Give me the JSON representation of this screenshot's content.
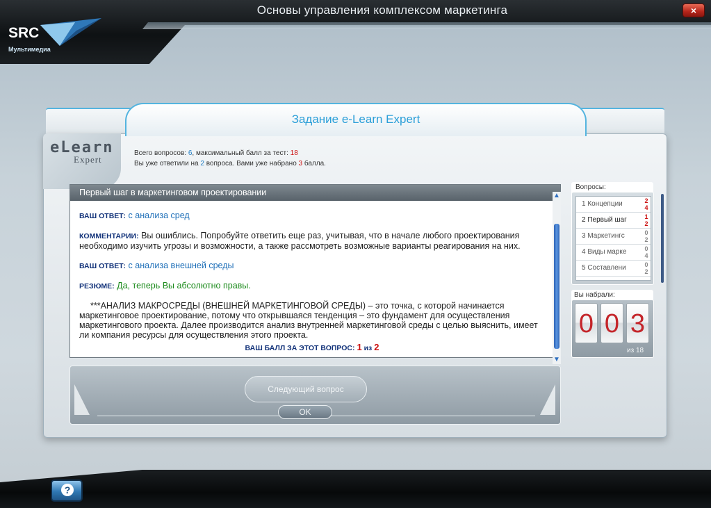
{
  "window": {
    "title": "Основы управления комплексом маркетинга",
    "close_label": "×",
    "logo": "SRC",
    "logo_sub": "Мультимедиа"
  },
  "colors": {
    "accent": "#2b9fd8",
    "score": "#cc1111",
    "label": "#13337a",
    "correct": "#1a8a1a"
  },
  "task": {
    "title": "Задание e-Learn Expert",
    "elogo_top": "eLearn",
    "elogo_bottom": "Expert",
    "stats": {
      "total_prefix": "Всего вопросов: ",
      "total": "6",
      "max_prefix": ", максимальный балл за тест: ",
      "max": "18",
      "answered_prefix": "Вы уже ответили на ",
      "answered": "2",
      "answered_mid": " вопроса. Вами уже набрано ",
      "scored": "3",
      "scored_suffix": " балла."
    }
  },
  "content": {
    "header": "Первый шаг в маркетинговом проектировании",
    "answer1_label": "ВАШ ОТВЕТ:",
    "answer1": " с анализа сред",
    "comment_label": "КОММЕНТАРИИ:",
    "comment": " Вы ошиблись. Попробуйте ответить еще раз, учитывая, что в начале любого проектирования необходимо изучить угрозы и возможности, а также рассмотреть возможные варианты реагирования на них.",
    "answer2_label": "ВАШ ОТВЕТ:",
    "answer2": " с анализа внешней среды",
    "summary_label": "РЕЗЮМЕ:",
    "summary": " Да, теперь Вы абсолютно правы.",
    "analysis": "***АНАЛИЗ МАКРОСРЕДЫ (ВНЕШНЕЙ МАРКЕТИНГОВОЙ СРЕДЫ) – это точка, с которой начинается маркетинговое проектирование, потому что открывшаяся тенденция – это фундамент для осуществления маркетингового проекта. Далее производится анализ внутренней маркетинговой среды с целью выяснить, имеет ли компания ресурсы для осуществления этого проекта.",
    "score_label": "ВАШ БАЛЛ ЗА ЭТОТ ВОПРОС:",
    "score_value": "1",
    "score_of": "из",
    "score_max": "2"
  },
  "controls": {
    "next_label": "Следующий вопрос",
    "ok_label": "OK"
  },
  "questions": {
    "label": "Вопросы:",
    "items": [
      {
        "label": "1  Концепции",
        "top": "2",
        "bottom": "4"
      },
      {
        "label": "2  Первый шаг",
        "top": "1",
        "bottom": "2"
      },
      {
        "label": "3  Маркетингс",
        "top": "0",
        "bottom": "2"
      },
      {
        "label": "4  Виды марке",
        "top": "0",
        "bottom": "4"
      },
      {
        "label": "5  Составлени",
        "top": "0",
        "bottom": "2"
      }
    ]
  },
  "score": {
    "label": "Вы набрали:",
    "digits": [
      "0",
      "0",
      "3"
    ],
    "of": "из 18"
  }
}
